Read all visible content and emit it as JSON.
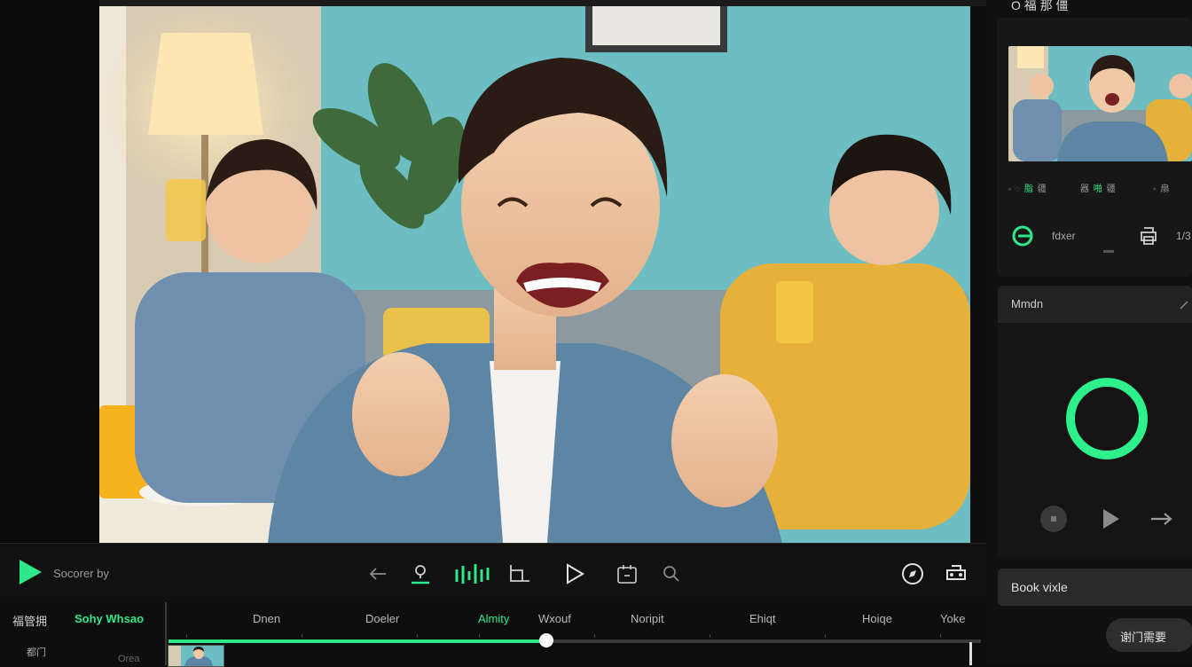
{
  "right_panel": {
    "title": "O 福 那 僵",
    "tiny_row_left": [
      "脂",
      "疆"
    ],
    "tiny_row_mid": [
      "器",
      "啪",
      "疆"
    ],
    "tiny_row_right": [
      "扇"
    ],
    "ctrl_label": "fdxer",
    "ctrl_right": "1/3",
    "section_title": "Mmdn",
    "book_video": "Book vixle",
    "floating_button": "谢门需要"
  },
  "player": {
    "source_label": "Socorer by"
  },
  "timeline": {
    "side_label": "福管拥",
    "active_track": "Sohy Whsao",
    "side_sub": "都门",
    "side_sub2": "Orea",
    "tracks": [
      "Dnen",
      "Doeler",
      "Almity",
      "Wxouf",
      "Noripit",
      "Ehiqt",
      "Hoiqe",
      "Yoke"
    ],
    "active_index": 2,
    "progress_fraction": 0.465
  },
  "colors": {
    "accent": "#2ee88a",
    "background": "#0d0d0d",
    "panel": "#171717"
  },
  "icons": [
    "play-icon",
    "back-arrow-icon",
    "pin-icon",
    "audio-waveform-icon",
    "crop-icon",
    "play-outline-icon",
    "clip-icon",
    "search-icon",
    "compass-icon",
    "share-icon",
    "green-circle-icon",
    "print-icon",
    "record-icon",
    "next-arrow-icon"
  ]
}
